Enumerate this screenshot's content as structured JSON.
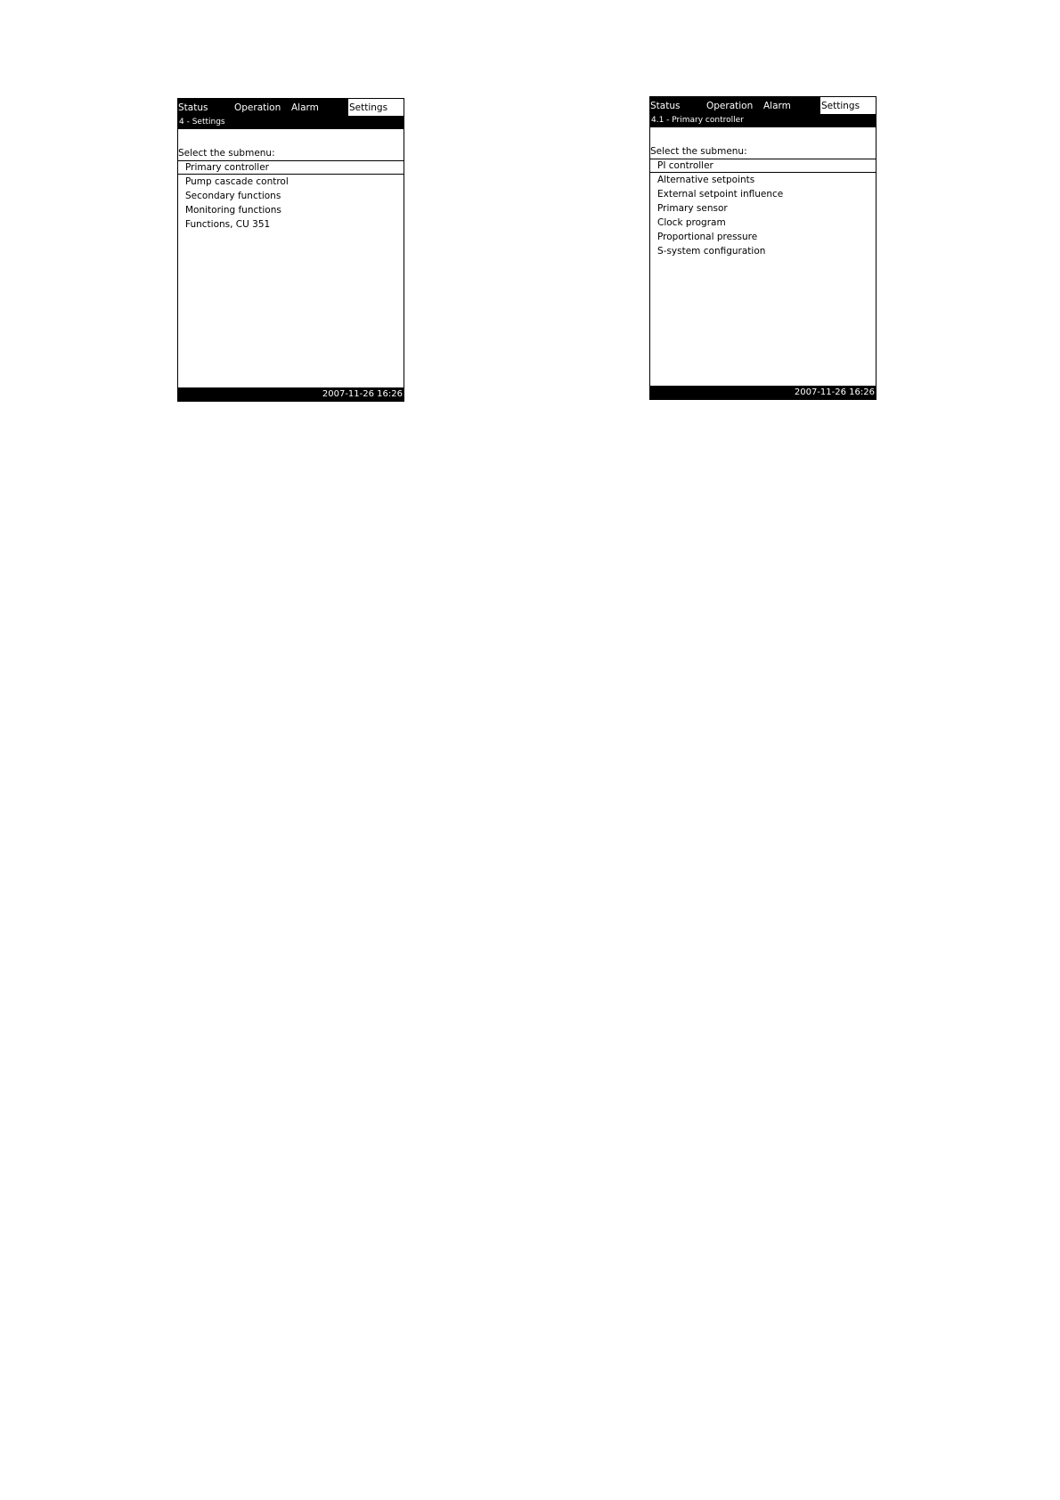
{
  "screens": [
    {
      "tabs": {
        "status": "Status",
        "operation": "Operation",
        "alarm": "Alarm",
        "settings": "Settings"
      },
      "active_tab": "Settings",
      "title": "4 - Settings",
      "prompt": "Select the submenu:",
      "items": [
        "Primary controller",
        "Pump cascade control",
        "Secondary functions",
        "Monitoring functions",
        "Functions, CU 351"
      ],
      "selected_item": "Primary controller",
      "datetime": "2007-11-26  16:26"
    },
    {
      "tabs": {
        "status": "Status",
        "operation": "Operation",
        "alarm": "Alarm",
        "settings": "Settings"
      },
      "active_tab": "Settings",
      "title": "4.1 - Primary controller",
      "prompt": "Select the submenu:",
      "items": [
        "PI controller",
        "Alternative setpoints",
        "External setpoint influence",
        "Primary sensor",
        "Clock program",
        "Proportional pressure",
        "S-system configuration"
      ],
      "selected_item": "PI controller",
      "datetime": "2007-11-26  16:26"
    }
  ]
}
